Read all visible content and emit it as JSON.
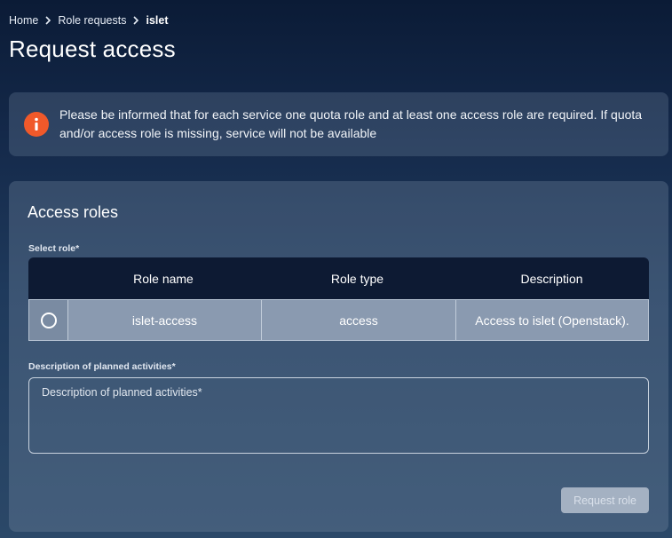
{
  "breadcrumb": {
    "items": [
      {
        "label": "Home"
      },
      {
        "label": "Role requests"
      },
      {
        "label": "islet"
      }
    ]
  },
  "page": {
    "title": "Request access"
  },
  "info": {
    "icon": "info-icon",
    "icon_color": "#f0592a",
    "text": "Please be informed that for each service one quota role and at least one access role are required. If quota and/or access role is missing, service will not be available"
  },
  "access_roles": {
    "title": "Access roles",
    "select_label": "Select role*",
    "columns": [
      "Role name",
      "Role type",
      "Description"
    ],
    "rows": [
      {
        "selected": false,
        "role_name": "islet-access",
        "role_type": "access",
        "description": "Access to islet (Openstack)."
      }
    ],
    "description_label": "Description of planned activities*",
    "description_placeholder": "Description of planned activities*",
    "description_value": "",
    "submit_label": "Request role",
    "submit_enabled": false
  }
}
